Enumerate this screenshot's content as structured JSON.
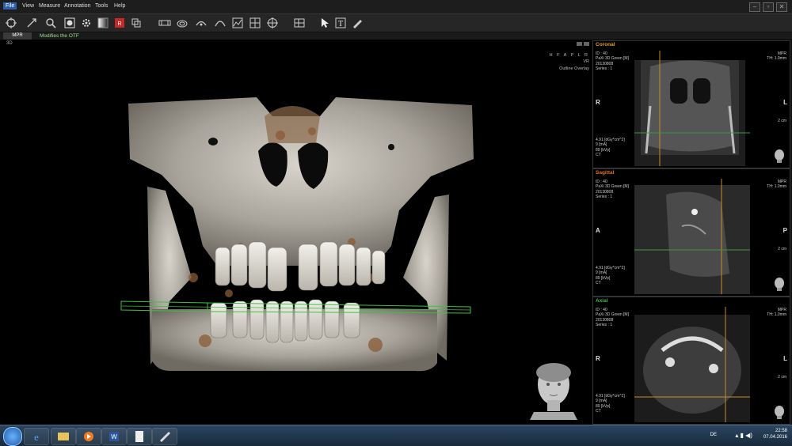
{
  "menu": {
    "items": [
      "File",
      "View",
      "Measure",
      "Annotation",
      "Tools",
      "Help"
    ],
    "active": "File"
  },
  "toolbar": {
    "icons": [
      "rotate-icon",
      "pan-icon",
      "zoom-icon",
      "window-level-icon",
      "settings-icon",
      "gradient-icon",
      "record-icon",
      "layout-icon",
      "film-icon",
      "arch-icon",
      "panorama-icon",
      "tmj-icon",
      "chart-icon",
      "grid-icon",
      "crosshair-icon",
      "layout-grid-icon",
      "pointer-icon",
      "text-icon",
      "pen-icon"
    ]
  },
  "tabs": {
    "active": "MPR",
    "status_message": "Modifies the OTF"
  },
  "view3d": {
    "label": "3D",
    "orientation": "H F A P L R",
    "mode": "VR",
    "overlay": "Outline Overlay"
  },
  "panels": [
    {
      "title": "Coronal",
      "title_color": "#e0a020",
      "id": "ID : 40",
      "name": "PaXi 3D Green [M]",
      "date": "20130808",
      "series": "Series : 1",
      "mpr": "MPR",
      "th": "TH: 1.0mm",
      "left_dir": "R",
      "right_dir": "L",
      "scale": "2 cm",
      "dose": "4.91  [dGy*cm^2]",
      "ma": "9  [mA]",
      "kvp": "89 [kVp]",
      "modality": "CT"
    },
    {
      "title": "Sagittal",
      "title_color": "#e07020",
      "id": "ID : 40",
      "name": "PaXi 3D Green [M]",
      "date": "20130808",
      "series": "Series : 1",
      "mpr": "MPR",
      "th": "TH: 1.0mm",
      "left_dir": "A",
      "right_dir": "P",
      "scale": "2 cm",
      "dose": "4.91  [dGy*cm^2]",
      "ma": "9  [mA]",
      "kvp": "89 [kVp]",
      "modality": "CT"
    },
    {
      "title": "Axial",
      "title_color": "#4caf50",
      "id": "ID : 40",
      "name": "PaXi 3D Green [M]",
      "date": "20130808",
      "series": "Series : 1",
      "mpr": "MPR",
      "th": "TH: 1.0mm",
      "left_dir": "R",
      "right_dir": "L",
      "scale": "2 cm",
      "dose": "4.91  [dGy*cm^2]",
      "ma": "9  [mA]",
      "kvp": "89 [kVp]",
      "modality": "CT"
    }
  ],
  "taskbar": {
    "apps": [
      "start-orb-icon",
      "internet-explorer-icon",
      "file-explorer-icon",
      "media-player-icon",
      "word-icon",
      "document-icon",
      "paint-icon"
    ],
    "language": "DE",
    "time": "22:58",
    "date": "07.04.2016"
  }
}
